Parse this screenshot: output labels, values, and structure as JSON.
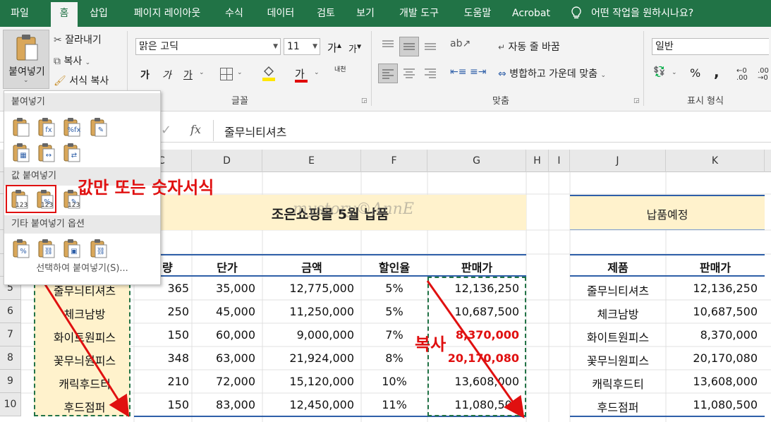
{
  "menu": {
    "tabs": [
      "파일",
      "홈",
      "삽입",
      "페이지 레이아웃",
      "수식",
      "데이터",
      "검토",
      "보기",
      "개발 도구",
      "도움말",
      "Acrobat"
    ],
    "search": "어떤 작업을 원하시나요?"
  },
  "clipboard": {
    "paste": "붙여넣기",
    "cut": "잘라내기",
    "copy": "복사",
    "format_painter": "서식 복사"
  },
  "font": {
    "name": "맑은 고딕",
    "size": "11",
    "group": "글꼴",
    "bold": "가",
    "italic": "가",
    "underline": "가",
    "color_letter": "가",
    "grow": "가",
    "shrink": "가",
    "phonetic": "내천"
  },
  "align": {
    "wrap": "자동 줄 바꿈",
    "merge": "병합하고 가운데 맞춤",
    "group": "맞춤"
  },
  "number": {
    "format": "일반",
    "group": "표시 형식",
    "percent": "%",
    "comma": ","
  },
  "formula_bar": {
    "fx": "fx",
    "value": "줄무늬티셔츠"
  },
  "columns": [
    "C",
    "D",
    "E",
    "F",
    "G",
    "H",
    "I",
    "J",
    "K"
  ],
  "rows": [
    "5",
    "6",
    "7",
    "8",
    "9",
    "10"
  ],
  "sheet": {
    "title": "조은쇼핑몰 5월 납품",
    "watermark": "mystory©AnnE",
    "right_title": "납품예정",
    "headers": [
      "량",
      "단가",
      "금액",
      "할인율",
      "판매가"
    ],
    "right_headers": [
      "제품",
      "판매가"
    ],
    "data": [
      {
        "name": "줄무늬티셔츠",
        "qty": "365",
        "price": "35,000",
        "amount": "12,775,000",
        "rate": "5%",
        "sale": "12,136,250"
      },
      {
        "name": "체크남방",
        "qty": "250",
        "price": "45,000",
        "amount": "11,250,000",
        "rate": "5%",
        "sale": "10,687,500"
      },
      {
        "name": "화이트원피스",
        "qty": "150",
        "price": "60,000",
        "amount": "9,000,000",
        "rate": "7%",
        "sale": "8,370,000"
      },
      {
        "name": "꽃무늬원피스",
        "qty": "348",
        "price": "63,000",
        "amount": "21,924,000",
        "rate": "8%",
        "sale": "20,170,080"
      },
      {
        "name": "캐릭후드티",
        "qty": "210",
        "price": "72,000",
        "amount": "15,120,000",
        "rate": "10%",
        "sale": "13,608,000"
      },
      {
        "name": "후드점퍼",
        "qty": "150",
        "price": "83,000",
        "amount": "12,450,000",
        "rate": "11%",
        "sale": "11,080,500"
      }
    ],
    "right": [
      {
        "name": "줄무늬티셔츠",
        "sale": "12,136,250"
      },
      {
        "name": "체크남방",
        "sale": "10,687,500"
      },
      {
        "name": "화이트원피스",
        "sale": "8,370,000"
      },
      {
        "name": "꽃무늬원피스",
        "sale": "20,170,080"
      },
      {
        "name": "캐릭후드티",
        "sale": "13,608,000"
      },
      {
        "name": "후드점퍼",
        "sale": "11,080,500"
      }
    ]
  },
  "paste_menu": {
    "sec1": "붙여넣기",
    "sec2": "값 붙여넣기",
    "sec3": "기타 붙여넣기 옵션",
    "special": "선택하여 붙여넣기(S)...",
    "badge": "123"
  },
  "annotations": {
    "values_only": "값만 또는 숫자서식",
    "copy": "복사"
  },
  "colors": {
    "excel_green": "#217346",
    "annotation_red": "#e01010",
    "title_fill": "#fff2cc",
    "header_border": "#2e5fa8"
  }
}
